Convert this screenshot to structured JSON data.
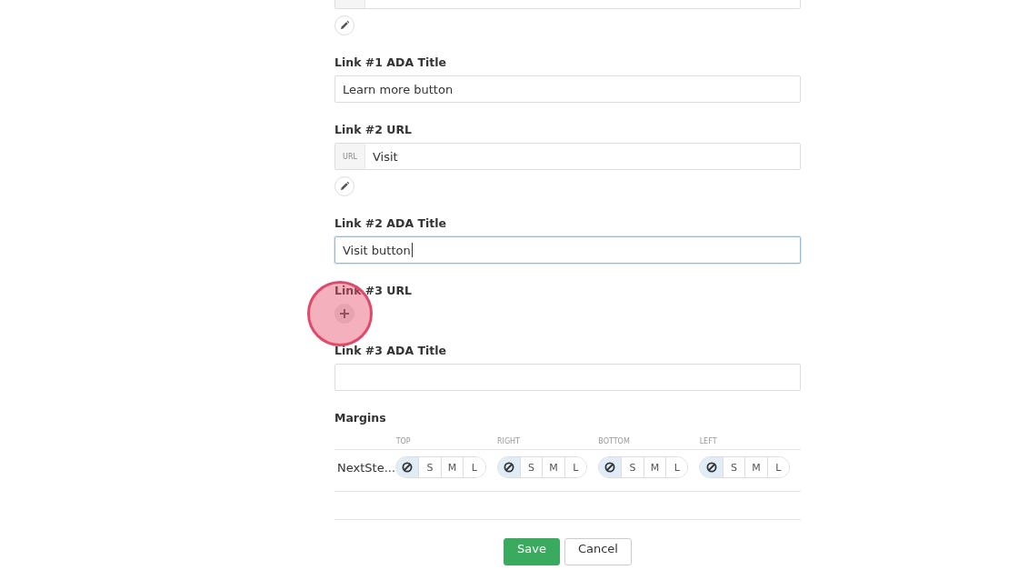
{
  "fields": [
    {
      "kind": "url",
      "edit_button": true
    },
    {
      "kind": "text",
      "label": "Link #1 ADA Title",
      "value": "Learn more button",
      "focused": false
    },
    {
      "kind": "url",
      "label": "Link #2 URL",
      "prefix": "URL",
      "value": "Visit",
      "edit_button": true
    },
    {
      "kind": "text",
      "label": "Link #2 ADA Title",
      "value": "Visit button",
      "focused": true
    },
    {
      "kind": "add",
      "label": "Link #3 URL",
      "click_indicator": true
    },
    {
      "kind": "text",
      "label": "Link #3 ADA Title",
      "focused": false
    }
  ],
  "margins": {
    "title": "Margins",
    "row_label": "NextSte...",
    "sides": [
      {
        "label": "TOP",
        "options": [
          {
            "kind": "none",
            "selected": true
          },
          {
            "kind": "size",
            "label": "S",
            "selected": false
          },
          {
            "kind": "size",
            "label": "M",
            "selected": false
          },
          {
            "kind": "size",
            "label": "L",
            "selected": false
          }
        ]
      },
      {
        "label": "RIGHT",
        "options": [
          {
            "kind": "none",
            "selected": true
          },
          {
            "kind": "size",
            "label": "S",
            "selected": false
          },
          {
            "kind": "size",
            "label": "M",
            "selected": false
          },
          {
            "kind": "size",
            "label": "L",
            "selected": false
          }
        ]
      },
      {
        "label": "BOTTOM",
        "options": [
          {
            "kind": "none",
            "selected": true
          },
          {
            "kind": "size",
            "label": "S",
            "selected": false
          },
          {
            "kind": "size",
            "label": "M",
            "selected": false
          },
          {
            "kind": "size",
            "label": "L",
            "selected": false
          }
        ]
      },
      {
        "label": "LEFT",
        "options": [
          {
            "kind": "none",
            "selected": true
          },
          {
            "kind": "size",
            "label": "S",
            "selected": false
          },
          {
            "kind": "size",
            "label": "M",
            "selected": false
          },
          {
            "kind": "size",
            "label": "L",
            "selected": false
          }
        ]
      }
    ]
  },
  "buttons": [
    {
      "kind": "primary",
      "label": "Save"
    },
    {
      "kind": "secondary",
      "label": "Cancel"
    }
  ]
}
